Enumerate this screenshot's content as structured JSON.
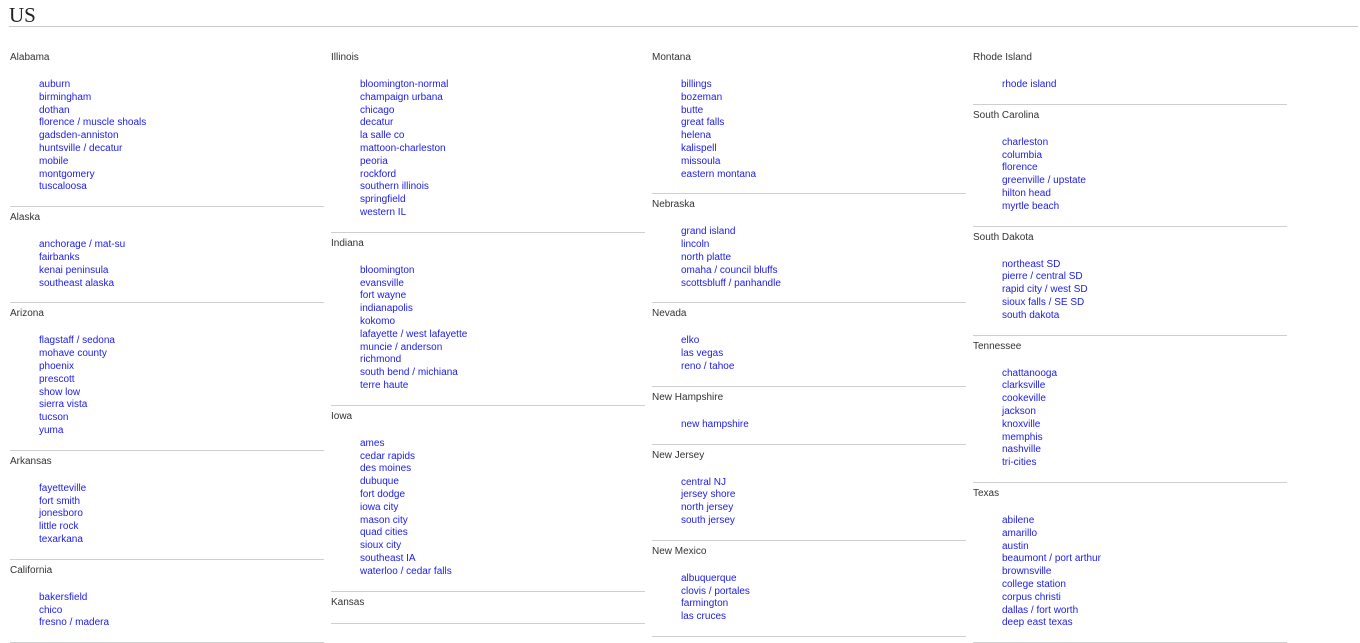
{
  "title": "US",
  "columns": [
    {
      "states": [
        {
          "name": "Alabama",
          "cities": [
            "auburn",
            "birmingham",
            "dothan",
            "florence / muscle shoals",
            "gadsden-anniston",
            "huntsville / decatur",
            "mobile",
            "montgomery",
            "tuscaloosa"
          ]
        },
        {
          "name": "Alaska",
          "cities": [
            "anchorage / mat-su",
            "fairbanks",
            "kenai peninsula",
            "southeast alaska"
          ]
        },
        {
          "name": "Arizona",
          "cities": [
            "flagstaff / sedona",
            "mohave county",
            "phoenix",
            "prescott",
            "show low",
            "sierra vista",
            "tucson",
            "yuma"
          ]
        },
        {
          "name": "Arkansas",
          "cities": [
            "fayetteville",
            "fort smith",
            "jonesboro",
            "little rock",
            "texarkana"
          ]
        },
        {
          "name": "California",
          "cities": [
            "bakersfield",
            "chico",
            "fresno / madera"
          ]
        }
      ]
    },
    {
      "states": [
        {
          "name": "Illinois",
          "cities": [
            "bloomington-normal",
            "champaign urbana",
            "chicago",
            "decatur",
            "la salle co",
            "mattoon-charleston",
            "peoria",
            "rockford",
            "southern illinois",
            "springfield",
            "western IL"
          ]
        },
        {
          "name": "Indiana",
          "cities": [
            "bloomington",
            "evansville",
            "fort wayne",
            "indianapolis",
            "kokomo",
            "lafayette / west lafayette",
            "muncie / anderson",
            "richmond",
            "south bend / michiana",
            "terre haute"
          ]
        },
        {
          "name": "Iowa",
          "cities": [
            "ames",
            "cedar rapids",
            "des moines",
            "dubuque",
            "fort dodge",
            "iowa city",
            "mason city",
            "quad cities",
            "sioux city",
            "southeast IA",
            "waterloo / cedar falls"
          ]
        },
        {
          "name": "Kansas",
          "cities": []
        }
      ]
    },
    {
      "states": [
        {
          "name": "Montana",
          "cities": [
            "billings",
            "bozeman",
            "butte",
            "great falls",
            "helena",
            "kalispell",
            "missoula",
            "eastern montana"
          ]
        },
        {
          "name": "Nebraska",
          "cities": [
            "grand island",
            "lincoln",
            "north platte",
            "omaha / council bluffs",
            "scottsbluff / panhandle"
          ]
        },
        {
          "name": "Nevada",
          "cities": [
            "elko",
            "las vegas",
            "reno / tahoe"
          ]
        },
        {
          "name": "New Hampshire",
          "cities": [
            "new hampshire"
          ]
        },
        {
          "name": "New Jersey",
          "cities": [
            "central NJ",
            "jersey shore",
            "north jersey",
            "south jersey"
          ]
        },
        {
          "name": "New Mexico",
          "cities": [
            "albuquerque",
            "clovis / portales",
            "farmington",
            "las cruces"
          ]
        }
      ]
    },
    {
      "states": [
        {
          "name": "Rhode Island",
          "cities": [
            "rhode island"
          ]
        },
        {
          "name": "South Carolina",
          "cities": [
            "charleston",
            "columbia",
            "florence",
            "greenville / upstate",
            "hilton head",
            "myrtle beach"
          ]
        },
        {
          "name": "South Dakota",
          "cities": [
            "northeast SD",
            "pierre / central SD",
            "rapid city / west SD",
            "sioux falls / SE SD",
            "south dakota"
          ]
        },
        {
          "name": "Tennessee",
          "cities": [
            "chattanooga",
            "clarksville",
            "cookeville",
            "jackson",
            "knoxville",
            "memphis",
            "nashville",
            "tri-cities"
          ]
        },
        {
          "name": "Texas",
          "cities": [
            "abilene",
            "amarillo",
            "austin",
            "beaumont / port arthur",
            "brownsville",
            "college station",
            "corpus christi",
            "dallas / fort worth",
            "deep east texas"
          ]
        }
      ]
    }
  ]
}
